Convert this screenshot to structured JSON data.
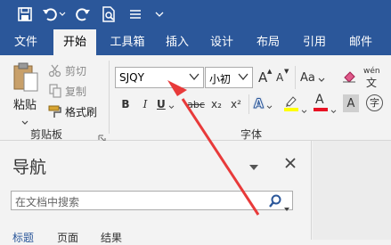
{
  "qat": {
    "icons": [
      "save-icon",
      "undo-icon",
      "redo-icon",
      "print-preview-icon",
      "touch-mode-icon",
      "customize-qat-icon"
    ]
  },
  "tabs": [
    {
      "label": "文件"
    },
    {
      "label": "开始"
    },
    {
      "label": "工具箱"
    },
    {
      "label": "插入"
    },
    {
      "label": "设计"
    },
    {
      "label": "布局"
    },
    {
      "label": "引用"
    },
    {
      "label": "邮件"
    }
  ],
  "clipboard": {
    "paste": "粘贴",
    "cut": "剪切",
    "copy": "复制",
    "format_painter": "格式刷",
    "group_label": "剪贴板"
  },
  "font": {
    "name": "SJQY",
    "size": "小初",
    "change_case": "Aa",
    "group_label": "字体",
    "bold": "B",
    "italic": "I",
    "underline": "U",
    "strike": "abc",
    "subscript": "x₂",
    "superscript": "x²",
    "grow": "A",
    "shrink": "A",
    "char_border": "A",
    "wen": "wén",
    "font_color": "A",
    "char_shading": "A"
  },
  "nav_pane": {
    "title": "导航",
    "search_placeholder": "在文档中搜索",
    "tabs": [
      "标题",
      "页面",
      "结果"
    ]
  },
  "colors": {
    "ribbon_blue": "#2b579a",
    "arrow_red": "#e83a3a",
    "font_color_bar": "#e81123",
    "highlight_bar": "#ffff00"
  }
}
